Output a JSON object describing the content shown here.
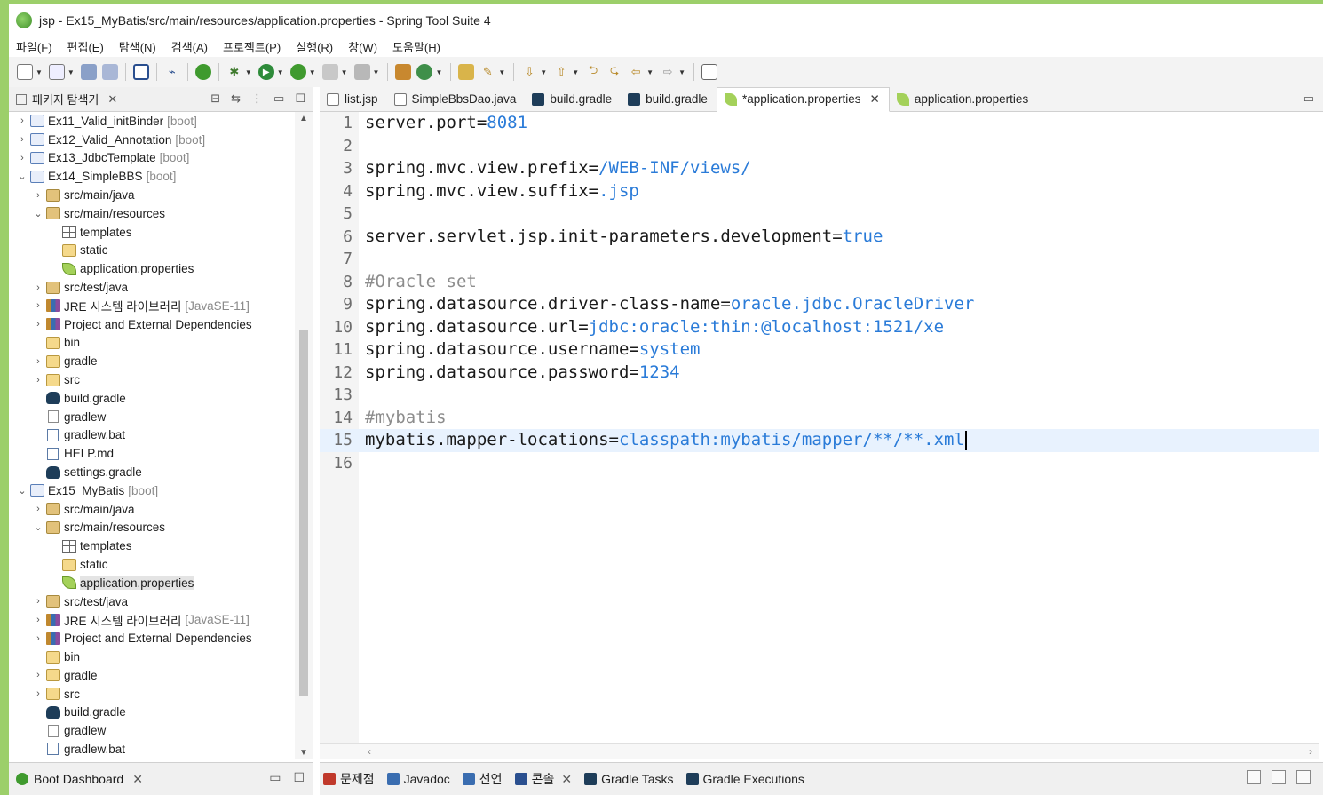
{
  "window": {
    "title": "jsp - Ex15_MyBatis/src/main/resources/application.properties - Spring Tool Suite 4"
  },
  "menu": [
    "파일(F)",
    "편집(E)",
    "탐색(N)",
    "검색(A)",
    "프로젝트(P)",
    "실행(R)",
    "창(W)",
    "도움말(H)"
  ],
  "explorer": {
    "title": "패키지 탐색기",
    "items": [
      {
        "label": "Ex11_Valid_initBinder",
        "suffix": "[boot]",
        "indent": 0,
        "chev": "›",
        "icon": "project-icon"
      },
      {
        "label": "Ex12_Valid_Annotation",
        "suffix": "[boot]",
        "indent": 0,
        "chev": "›",
        "icon": "project-icon"
      },
      {
        "label": "Ex13_JdbcTemplate",
        "suffix": "[boot]",
        "indent": 0,
        "chev": "›",
        "icon": "project-icon"
      },
      {
        "label": "Ex14_SimpleBBS",
        "suffix": "[boot]",
        "indent": 0,
        "chev": "⌄",
        "icon": "project-icon"
      },
      {
        "label": "src/main/java",
        "suffix": "",
        "indent": 1,
        "chev": "›",
        "icon": "source-folder-icon"
      },
      {
        "label": "src/main/resources",
        "suffix": "",
        "indent": 1,
        "chev": "⌄",
        "icon": "source-folder-icon"
      },
      {
        "label": "templates",
        "suffix": "",
        "indent": 2,
        "chev": "",
        "icon": "grid-folder-icon"
      },
      {
        "label": "static",
        "suffix": "",
        "indent": 2,
        "chev": "",
        "icon": "folder-icon"
      },
      {
        "label": "application.properties",
        "suffix": "",
        "indent": 2,
        "chev": "",
        "icon": "properties-leaf-icon"
      },
      {
        "label": "src/test/java",
        "suffix": "",
        "indent": 1,
        "chev": "›",
        "icon": "source-folder-icon"
      },
      {
        "label": "JRE 시스템 라이브러리",
        "suffix": "[JavaSE-11]",
        "indent": 1,
        "chev": "›",
        "icon": "library-icon"
      },
      {
        "label": "Project and External Dependencies",
        "suffix": "",
        "indent": 1,
        "chev": "›",
        "icon": "library-icon"
      },
      {
        "label": "bin",
        "suffix": "",
        "indent": 1,
        "chev": "",
        "icon": "folder-icon"
      },
      {
        "label": "gradle",
        "suffix": "",
        "indent": 1,
        "chev": "›",
        "icon": "folder-icon"
      },
      {
        "label": "src",
        "suffix": "",
        "indent": 1,
        "chev": "›",
        "icon": "folder-icon"
      },
      {
        "label": "build.gradle",
        "suffix": "",
        "indent": 1,
        "chev": "",
        "icon": "gradle-icon"
      },
      {
        "label": "gradlew",
        "suffix": "",
        "indent": 1,
        "chev": "",
        "icon": "file-icon"
      },
      {
        "label": "gradlew.bat",
        "suffix": "",
        "indent": 1,
        "chev": "",
        "icon": "bat-file-icon"
      },
      {
        "label": "HELP.md",
        "suffix": "",
        "indent": 1,
        "chev": "",
        "icon": "bat-file-icon"
      },
      {
        "label": "settings.gradle",
        "suffix": "",
        "indent": 1,
        "chev": "",
        "icon": "gradle-icon"
      },
      {
        "label": "Ex15_MyBatis",
        "suffix": "[boot]",
        "indent": 0,
        "chev": "⌄",
        "icon": "project-icon"
      },
      {
        "label": "src/main/java",
        "suffix": "",
        "indent": 1,
        "chev": "›",
        "icon": "source-folder-icon"
      },
      {
        "label": "src/main/resources",
        "suffix": "",
        "indent": 1,
        "chev": "⌄",
        "icon": "source-folder-icon"
      },
      {
        "label": "templates",
        "suffix": "",
        "indent": 2,
        "chev": "",
        "icon": "grid-folder-icon"
      },
      {
        "label": "static",
        "suffix": "",
        "indent": 2,
        "chev": "",
        "icon": "folder-icon"
      },
      {
        "label": "application.properties",
        "suffix": "",
        "indent": 2,
        "chev": "",
        "icon": "properties-leaf-icon",
        "selected": true
      },
      {
        "label": "src/test/java",
        "suffix": "",
        "indent": 1,
        "chev": "›",
        "icon": "source-folder-icon"
      },
      {
        "label": "JRE 시스템 라이브러리",
        "suffix": "[JavaSE-11]",
        "indent": 1,
        "chev": "›",
        "icon": "library-icon"
      },
      {
        "label": "Project and External Dependencies",
        "suffix": "",
        "indent": 1,
        "chev": "›",
        "icon": "library-icon"
      },
      {
        "label": "bin",
        "suffix": "",
        "indent": 1,
        "chev": "",
        "icon": "folder-icon"
      },
      {
        "label": "gradle",
        "suffix": "",
        "indent": 1,
        "chev": "›",
        "icon": "folder-icon"
      },
      {
        "label": "src",
        "suffix": "",
        "indent": 1,
        "chev": "›",
        "icon": "folder-icon"
      },
      {
        "label": "build.gradle",
        "suffix": "",
        "indent": 1,
        "chev": "",
        "icon": "gradle-icon"
      },
      {
        "label": "gradlew",
        "suffix": "",
        "indent": 1,
        "chev": "",
        "icon": "file-icon"
      },
      {
        "label": "gradlew.bat",
        "suffix": "",
        "indent": 1,
        "chev": "",
        "icon": "bat-file-icon"
      }
    ]
  },
  "editor": {
    "tabs": [
      {
        "label": "list.jsp",
        "icon": "jsp-file-icon",
        "active": false,
        "closable": false
      },
      {
        "label": "SimpleBbsDao.java",
        "icon": "java-file-icon",
        "active": false,
        "closable": false
      },
      {
        "label": "build.gradle",
        "icon": "gradle-icon",
        "active": false,
        "closable": false
      },
      {
        "label": "build.gradle",
        "icon": "gradle-icon",
        "active": false,
        "closable": false
      },
      {
        "label": "*application.properties",
        "icon": "properties-leaf-icon",
        "active": true,
        "closable": true
      },
      {
        "label": "application.properties",
        "icon": "properties-leaf-icon",
        "active": false,
        "closable": false
      }
    ],
    "lines": [
      {
        "n": "1",
        "key": "server.port=",
        "val": "8081",
        "comment": ""
      },
      {
        "n": "2",
        "key": "",
        "val": "",
        "comment": ""
      },
      {
        "n": "3",
        "key": "spring.mvc.view.prefix=",
        "val": "/WEB-INF/views/",
        "comment": ""
      },
      {
        "n": "4",
        "key": "spring.mvc.view.suffix=",
        "val": ".jsp",
        "comment": ""
      },
      {
        "n": "5",
        "key": "",
        "val": "",
        "comment": ""
      },
      {
        "n": "6",
        "key": "server.servlet.jsp.init-parameters.development=",
        "val": "true",
        "comment": ""
      },
      {
        "n": "7",
        "key": "",
        "val": "",
        "comment": ""
      },
      {
        "n": "8",
        "key": "",
        "val": "",
        "comment": "#Oracle set"
      },
      {
        "n": "9",
        "key": "spring.datasource.driver-class-name=",
        "val": "oracle.jdbc.OracleDriver",
        "comment": ""
      },
      {
        "n": "10",
        "key": "spring.datasource.url=",
        "val": "jdbc:oracle:thin:@localhost:1521/xe",
        "comment": ""
      },
      {
        "n": "11",
        "key": "spring.datasource.username=",
        "val": "system",
        "comment": ""
      },
      {
        "n": "12",
        "key": "spring.datasource.password=",
        "val": "1234",
        "comment": ""
      },
      {
        "n": "13",
        "key": "",
        "val": "",
        "comment": ""
      },
      {
        "n": "14",
        "key": "",
        "val": "",
        "comment": "#mybatis"
      },
      {
        "n": "15",
        "key": "mybatis.mapper-locations=",
        "val": "classpath:mybatis/mapper/**/**.xml",
        "comment": "",
        "current": true
      },
      {
        "n": "16",
        "key": "",
        "val": "",
        "comment": ""
      }
    ]
  },
  "bottom_left": {
    "label": "Boot Dashboard"
  },
  "bottom_tabs": [
    {
      "label": "문제점",
      "icon": "problems-icon",
      "closable": false
    },
    {
      "label": "Javadoc",
      "icon": "javadoc-icon",
      "closable": false
    },
    {
      "label": "선언",
      "icon": "declaration-icon",
      "closable": false
    },
    {
      "label": "콘솔",
      "icon": "console-icon",
      "closable": true
    },
    {
      "label": "Gradle Tasks",
      "icon": "gradle-icon",
      "closable": false
    },
    {
      "label": "Gradle Executions",
      "icon": "gradle-icon",
      "closable": false
    }
  ],
  "colors": {
    "accent": "#9ccf6a",
    "value_text": "#2a7bd8",
    "comment_text": "#8c8c8c",
    "current_line": "#e8f2fe"
  }
}
